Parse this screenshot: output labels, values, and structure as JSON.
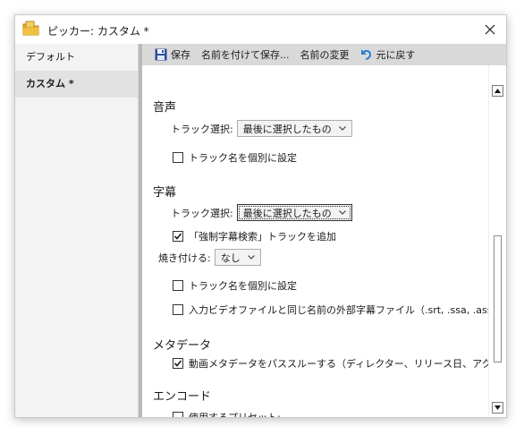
{
  "window": {
    "title": "ピッカー: カスタム *",
    "close_label": "✕"
  },
  "sidebar": {
    "items": [
      {
        "label": "デフォルト",
        "active": false
      },
      {
        "label": "カスタム *",
        "active": true
      }
    ]
  },
  "toolbar": {
    "save_label": "保存",
    "save_as_label": "名前を付けて保存...",
    "rename_label": "名前の変更",
    "revert_label": "元に戻す"
  },
  "audio": {
    "heading": "音声",
    "track_select_label": "トラック選択:",
    "track_select_value": "最後に選択したもの",
    "individual_names_label": "トラック名を個別に設定",
    "individual_names_checked": false
  },
  "subtitles": {
    "heading": "字幕",
    "track_select_label": "トラック選択:",
    "track_select_value": "最後に選択したもの",
    "forced_search_label": "「強制字幕検索」トラックを追加",
    "forced_search_checked": true,
    "burn_in_label": "焼き付ける:",
    "burn_in_value": "なし",
    "individual_names_label": "トラック名を個別に設定",
    "individual_names_checked": false,
    "external_files_label": "入力ビデオファイルと同じ名前の外部字幕ファイル（.srt, .ssa, .ass）を",
    "external_files_checked": false
  },
  "metadata": {
    "heading": "メタデータ",
    "passthrough_label": "動画メタデータをパススルーする（ディレクター、リリース日、アクターなど）",
    "passthrough_checked": true
  },
  "encode": {
    "heading": "エンコード",
    "use_preset_label": "使用するプリセット:",
    "use_preset_checked": false
  },
  "icons": {
    "app": "folder-icon",
    "save": "floppy-disk-icon",
    "revert": "undo-arrow-icon",
    "checkmark": "checkmark-icon"
  },
  "colors": {
    "toolbar_bg": "#d9d9d9",
    "sidebar_bg": "#f3f3f3",
    "sidebar_active_bg": "#e2e2e2",
    "divider": "#b9b9b9",
    "save_icon": "#2b4f9e",
    "revert_icon": "#2a7fd4",
    "app_icon": "#e8b230"
  }
}
